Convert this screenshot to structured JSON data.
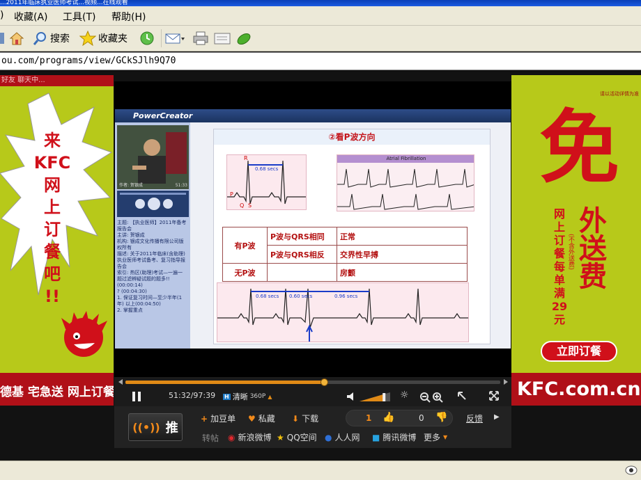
{
  "window": {
    "title": "...2011年临床执业医师考试...视频...在线观看"
  },
  "menu": {
    "items": [
      "收藏(A)",
      "工具(T)",
      "帮助(H)"
    ],
    "leading": ")"
  },
  "toolbar": {
    "search_label": "搜索",
    "favorites_label": "收藏夹"
  },
  "address": {
    "url": "ou.com/programs/view/GCkSJlh9Q70"
  },
  "ad_left": {
    "top_text": "好友 聊天中...",
    "headline": [
      "来",
      "KFC",
      "网",
      "上",
      "订",
      "餐",
      "吧",
      "!!"
    ],
    "footer": "德基 宅急送 网上订餐"
  },
  "ad_right": {
    "top_text": "请以活动详情为准",
    "big_char": "免",
    "main": "外送费",
    "side": [
      "网",
      "上",
      "订",
      "餐",
      "每",
      "单",
      "满",
      "29",
      "元"
    ],
    "side_note": "(不含外送费)",
    "cta": "立即订餐",
    "footer": "KFC.com.cn"
  },
  "player": {
    "brand": "PowerCreator",
    "speaker_caption": "作者: 贺银成",
    "video_time": "51:33",
    "info_lines": [
      "主题: 【执业医师】2011年备考报告会",
      "主讲: 贺银成",
      "机构: 银成文化传播有限公司版权所有",
      "描述: 关于2011年临床(含助理)执业医师考试备考、复习指导报告会",
      "索引: 热区(助理)考试—一遍一题过滤辨疑试题的题多!! (00:00:14)",
      "? (00:04:30)",
      "1. 保证复习时间—至少半年(1年) 以上(00:04:50)",
      "2. 掌握重点"
    ],
    "slide": {
      "title": "②看P波方向",
      "ecg1_label": "0.68 secs",
      "ecg1_marks": [
        "R",
        "P",
        "Q",
        "S"
      ],
      "ecg2_label": "Atrial Fibrillation",
      "table": [
        [
          "有P波",
          "P波与QRS相同",
          "正常"
        ],
        [
          "",
          "P波与QRS相反",
          "交界性早搏"
        ],
        [
          "无P波",
          "",
          "房颤"
        ]
      ],
      "ecg3_labels": [
        "0.68 secs",
        "0.60 secs",
        "0.96 secs"
      ]
    },
    "progress": 0.532,
    "time_display": "51:32/97:39",
    "quality_label": "清晰",
    "quality_value": "360P",
    "volume": 0.8
  },
  "social": {
    "push_label": "推",
    "add_douban": "加豆单",
    "private": "私藏",
    "download": "下载",
    "like_count": "1",
    "dislike_count": "0",
    "feedback": "反馈",
    "share_label": "转帖",
    "sina": "新浪微博",
    "qzone": "QQ空间",
    "renren": "人人网",
    "tencent": "腾讯微博",
    "more": "更多"
  }
}
